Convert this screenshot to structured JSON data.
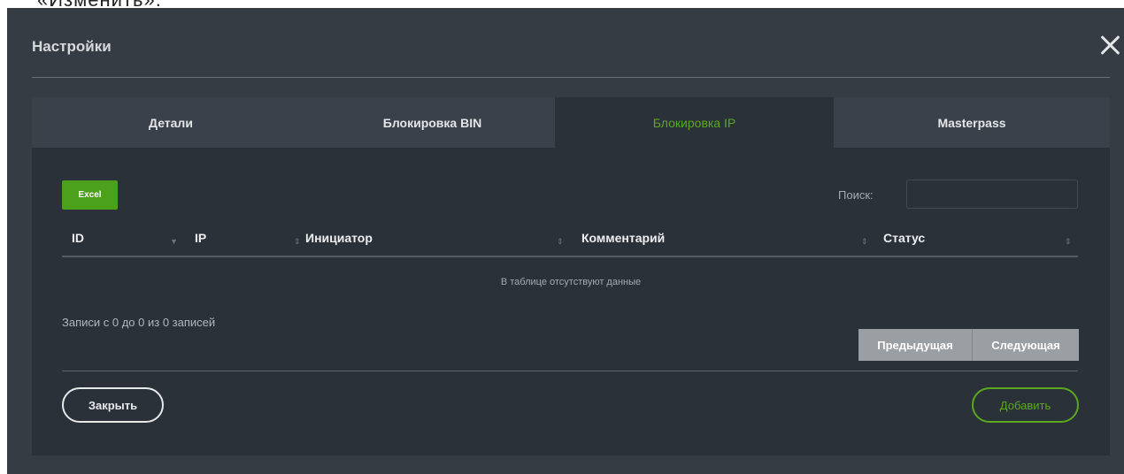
{
  "page_fragment": "«Изменить».",
  "modal": {
    "title": "Настройки",
    "close_icon": "close-icon"
  },
  "tabs": [
    {
      "label": "Детали",
      "active": false
    },
    {
      "label": "Блокировка BIN",
      "active": false
    },
    {
      "label": "Блокировка IP",
      "active": true
    },
    {
      "label": "Masterpass",
      "active": false
    }
  ],
  "toolbar": {
    "excel_label": "Excel",
    "search_label": "Поиск:",
    "search_value": ""
  },
  "table": {
    "columns": [
      "ID",
      "IP",
      "Инициатор",
      "Комментарий",
      "Статус"
    ],
    "empty_text": "В таблице отсутствуют данные"
  },
  "info": "Записи с 0 до 0 из 0 записей",
  "pagination": {
    "prev_label": "Предыдущая",
    "next_label": "Следующая"
  },
  "footer": {
    "close_label": "Закрыть",
    "add_label": "Добавить"
  },
  "colors": {
    "accent": "#5aa91d",
    "excel": "#4ba11b",
    "modal_bg": "#363c44",
    "panel_bg": "#2b3139"
  }
}
